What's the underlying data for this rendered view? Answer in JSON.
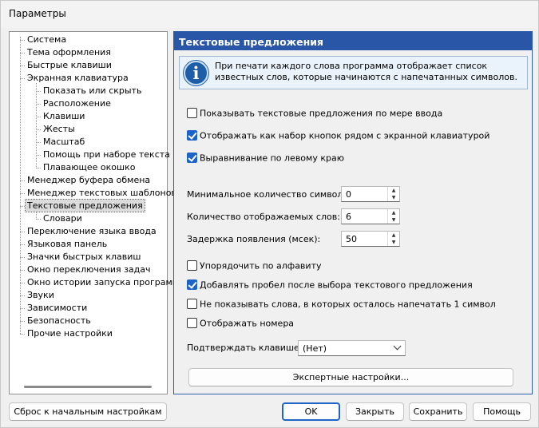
{
  "window": {
    "title": "Параметры"
  },
  "tree": {
    "items": [
      {
        "label": "Система",
        "level": 0
      },
      {
        "label": "Тема оформления",
        "level": 0
      },
      {
        "label": "Быстрые клавиши",
        "level": 0
      },
      {
        "label": "Экранная клавиатура",
        "level": 0
      },
      {
        "label": "Показать или скрыть",
        "level": 1
      },
      {
        "label": "Расположение",
        "level": 1
      },
      {
        "label": "Клавиши",
        "level": 1
      },
      {
        "label": "Жесты",
        "level": 1
      },
      {
        "label": "Масштаб",
        "level": 1
      },
      {
        "label": "Помощь при наборе текста",
        "level": 1
      },
      {
        "label": "Плавающее окошко",
        "level": 1
      },
      {
        "label": "Менеджер буфера обмена",
        "level": 0
      },
      {
        "label": "Менеджер текстовых шаблонов",
        "level": 0
      },
      {
        "label": "Текстовые предложения",
        "level": 0,
        "selected": true
      },
      {
        "label": "Словари",
        "level": 1
      },
      {
        "label": "Переключение языка ввода",
        "level": 0
      },
      {
        "label": "Языковая панель",
        "level": 0
      },
      {
        "label": "Значки быстрых клавиш",
        "level": 0
      },
      {
        "label": "Окно переключения задач",
        "level": 0
      },
      {
        "label": "Окно истории запуска программ",
        "level": 0
      },
      {
        "label": "Звуки",
        "level": 0
      },
      {
        "label": "Зависимости",
        "level": 0
      },
      {
        "label": "Безопасность",
        "level": 0
      },
      {
        "label": "Прочие настройки",
        "level": 0
      }
    ]
  },
  "panel": {
    "header": "Текстовые предложения",
    "info": "При печати каждого слова программа отображает список известных слов, которые начинаются с напечатанных символов.",
    "checkboxes_top": [
      {
        "label": "Показывать текстовые предложения по мере ввода",
        "checked": false
      },
      {
        "label": "Отображать как набор кнопок рядом с экранной клавиатурой",
        "checked": true
      },
      {
        "label": "Выравнивание по левому краю",
        "checked": true
      }
    ],
    "fields": [
      {
        "label": "Минимальное количество символов:",
        "value": "0"
      },
      {
        "label": "Количество отображаемых слов:",
        "value": "6"
      },
      {
        "label": "Задержка появления (мсек):",
        "value": "50"
      }
    ],
    "checkboxes_bottom": [
      {
        "label": "Упорядочить по алфавиту",
        "checked": false
      },
      {
        "label": "Добавлять пробел после выбора текстового предложения",
        "checked": true
      },
      {
        "label": "Не показывать слова, в которых осталось напечатать 1 символ",
        "checked": false
      },
      {
        "label": "Отображать номера",
        "checked": false
      }
    ],
    "confirm_label": "Подтверждать клавишей:",
    "confirm_value": "(Нет)",
    "expert_button": "Экспертные настройки..."
  },
  "buttons": {
    "reset": "Сброс к начальным настройкам",
    "ok": "OK",
    "close": "Закрыть",
    "save": "Сохранить",
    "help": "Помощь"
  },
  "colors": {
    "accent": "#2a56a8",
    "checkbox": "#1e63c7"
  }
}
